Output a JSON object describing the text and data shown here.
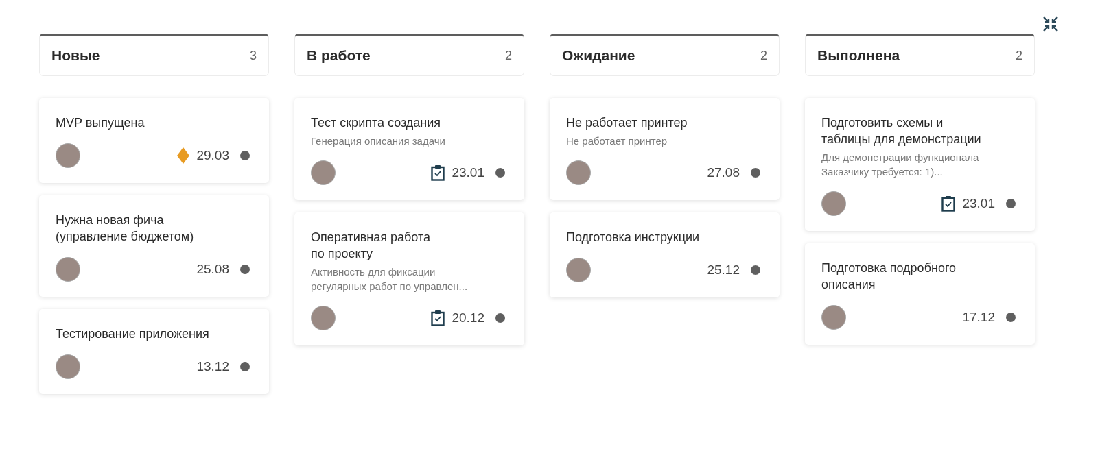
{
  "columns": [
    {
      "title": "Новые",
      "count": "3",
      "cards": [
        {
          "title": "MVP выпущена",
          "priority": true,
          "checklist": false,
          "date": "29.03",
          "color": "#5f5f5f"
        },
        {
          "title": "Нужна новая фича\n(управление бюджетом)",
          "priority": false,
          "checklist": false,
          "date": "25.08",
          "color": "#5f5f5f"
        },
        {
          "title": "Тестирование приложения",
          "priority": false,
          "checklist": false,
          "date": "13.12",
          "color": "#5f5f5f"
        }
      ]
    },
    {
      "title": "В работе",
      "count": "2",
      "cards": [
        {
          "title": "Тест скрипта создания",
          "description": "Генерация описания задачи",
          "priority": false,
          "checklist": true,
          "date": "23.01",
          "color": "#5f5f5f"
        },
        {
          "title": "Оперативная работа\nпо проекту",
          "description": "Активность для фиксации\nрегулярных работ по управлен...",
          "priority": false,
          "checklist": true,
          "date": "20.12",
          "color": "#5f5f5f"
        }
      ]
    },
    {
      "title": "Ожидание",
      "count": "2",
      "cards": [
        {
          "title": "Не работает принтер",
          "description": "Не работает принтер",
          "priority": false,
          "checklist": false,
          "date": "27.08",
          "color": "#5f5f5f"
        },
        {
          "title": "Подготовка инструкции",
          "priority": false,
          "checklist": false,
          "date": "25.12",
          "color": "#5f5f5f"
        }
      ]
    },
    {
      "title": "Выполнена",
      "count": "2",
      "cards": [
        {
          "title": "Подготовить схемы и\nтаблицы для демонстрации",
          "description": "Для демонстрации функционала\nЗаказчику требуется: 1)...",
          "priority": false,
          "checklist": true,
          "date": "23.01",
          "color": "#5f5f5f"
        },
        {
          "title": "Подготовка подробного\nописания",
          "priority": false,
          "checklist": false,
          "date": "17.12",
          "color": "#5f5f5f"
        }
      ]
    }
  ]
}
